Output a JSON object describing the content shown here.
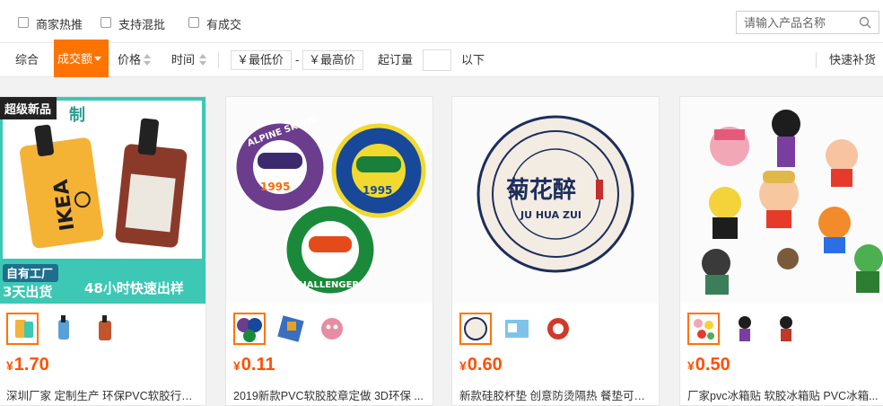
{
  "filters": {
    "checkboxes": [
      {
        "label": "商家热推",
        "checked": false
      },
      {
        "label": "支持混批",
        "checked": false
      },
      {
        "label": "有成交",
        "checked": false
      }
    ],
    "search_placeholder": "请输入产品名称"
  },
  "sort": {
    "default_label": "综合",
    "active_label": "成交额",
    "price_label": "价格",
    "time_label": "时间",
    "min_price_placeholder": "￥最低价",
    "dash": "-",
    "max_price_placeholder": "￥最高价",
    "moq_label": "起订量",
    "below_label": "以下",
    "quick_restock_label": "快速补货"
  },
  "colors": {
    "accent": "#ff7300",
    "price": "#ff5000"
  },
  "products": [
    {
      "badge": "超级新品",
      "image_texts": [
        "制",
        "IKEA",
        "自有工厂",
        "3天出货",
        "48小时快速出样"
      ],
      "price_currency": "¥",
      "price": "1.70",
      "title": "深圳厂家 定制生产 环保PVC软胶行李..."
    },
    {
      "image_texts": [
        "ALPINE SKIING",
        "1995",
        "CHALLENGER"
      ],
      "price_currency": "¥",
      "price": "0.11",
      "title": "2019新款PVC软胶胶章定做 3D环保 ..."
    },
    {
      "image_texts": [
        "菊花醉",
        "JU HUA ZUI"
      ],
      "price_currency": "¥",
      "price": "0.60",
      "title": "新款硅胶杯垫 创意防烫隔热 餐垫可丝..."
    },
    {
      "price_currency": "¥",
      "price": "0.50",
      "title": "厂家pvc冰箱贴 软胶冰箱贴 PVC冰箱..."
    }
  ]
}
